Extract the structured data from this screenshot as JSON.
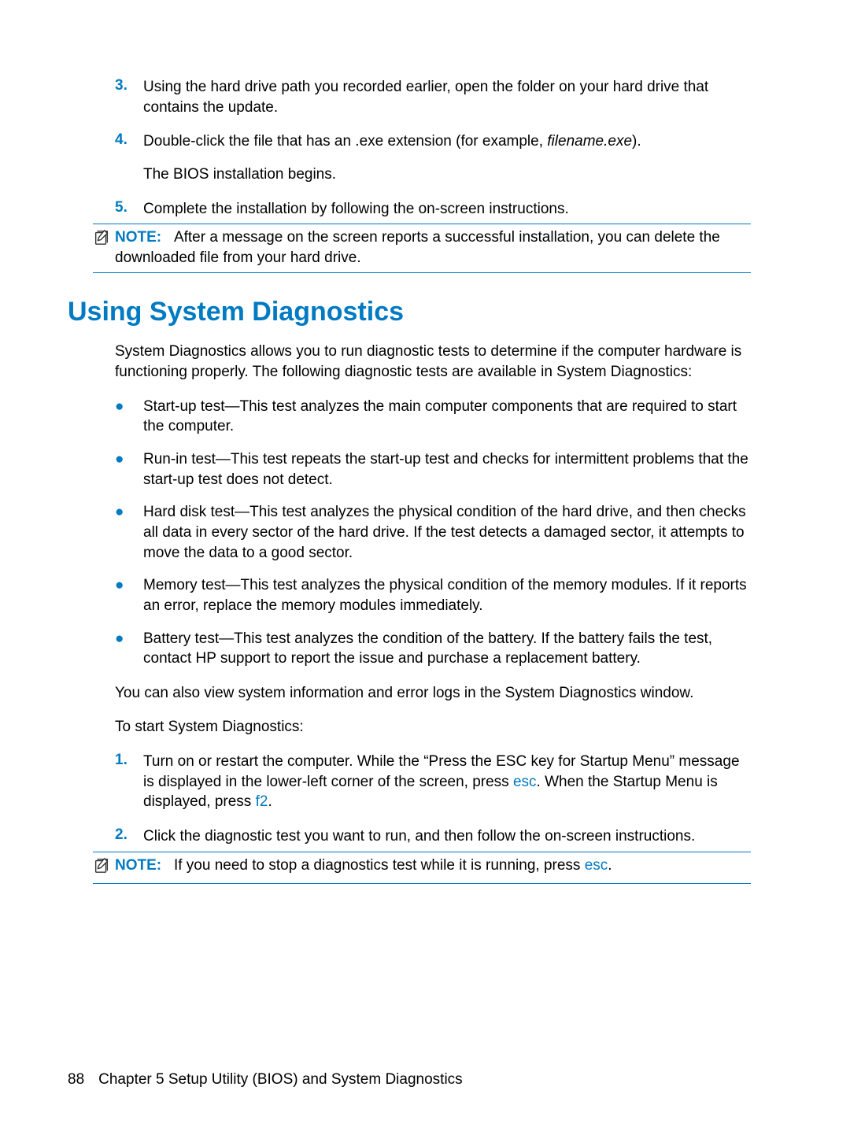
{
  "steps_a": [
    {
      "num": "3.",
      "text": "Using the hard drive path you recorded earlier, open the folder on your hard drive that contains the update."
    },
    {
      "num": "4.",
      "text_parts": [
        "Double-click the file that has an .exe extension (for example, ",
        "filename.exe",
        ")."
      ],
      "follow": "The BIOS installation begins."
    },
    {
      "num": "5.",
      "text": "Complete the installation by following the on-screen instructions."
    }
  ],
  "note1": {
    "label": "NOTE:",
    "text": "After a message on the screen reports a successful installation, you can delete the downloaded file from your hard drive."
  },
  "heading": "Using System Diagnostics",
  "intro": "System Diagnostics allows you to run diagnostic tests to determine if the computer hardware is functioning properly. The following diagnostic tests are available in System Diagnostics:",
  "bullets": [
    "Start-up test—This test analyzes the main computer components that are required to start the computer.",
    "Run-in test—This test repeats the start-up test and checks for intermittent problems that the start-up test does not detect.",
    "Hard disk test—This test analyzes the physical condition of the hard drive, and then checks all data in every sector of the hard drive. If the test detects a damaged sector, it attempts to move the data to a good sector.",
    "Memory test—This test analyzes the physical condition of the memory modules. If it reports an error, replace the memory modules immediately.",
    "Battery test—This test analyzes the condition of the battery. If the battery fails the test, contact HP support to report the issue and purchase a replacement battery."
  ],
  "post_bullets": [
    "You can also view system information and error logs in the System Diagnostics window.",
    "To start System Diagnostics:"
  ],
  "steps_b": {
    "item1": {
      "num": "1.",
      "part1": "Turn on or restart the computer. While the “Press the ESC key for Startup Menu” message is displayed in the lower-left corner of the screen, press ",
      "key1": "esc",
      "part2": ". When the Startup Menu is displayed, press ",
      "key2": "f2",
      "part3": "."
    },
    "item2": {
      "num": "2.",
      "text": "Click the diagnostic test you want to run, and then follow the on-screen instructions."
    }
  },
  "note2": {
    "label": "NOTE:",
    "pre": "If you need to stop a diagnostics test while it is running, press ",
    "key": "esc",
    "post": "."
  },
  "footer": {
    "page_num": "88",
    "chapter": "Chapter 5   Setup Utility (BIOS) and System Diagnostics"
  }
}
